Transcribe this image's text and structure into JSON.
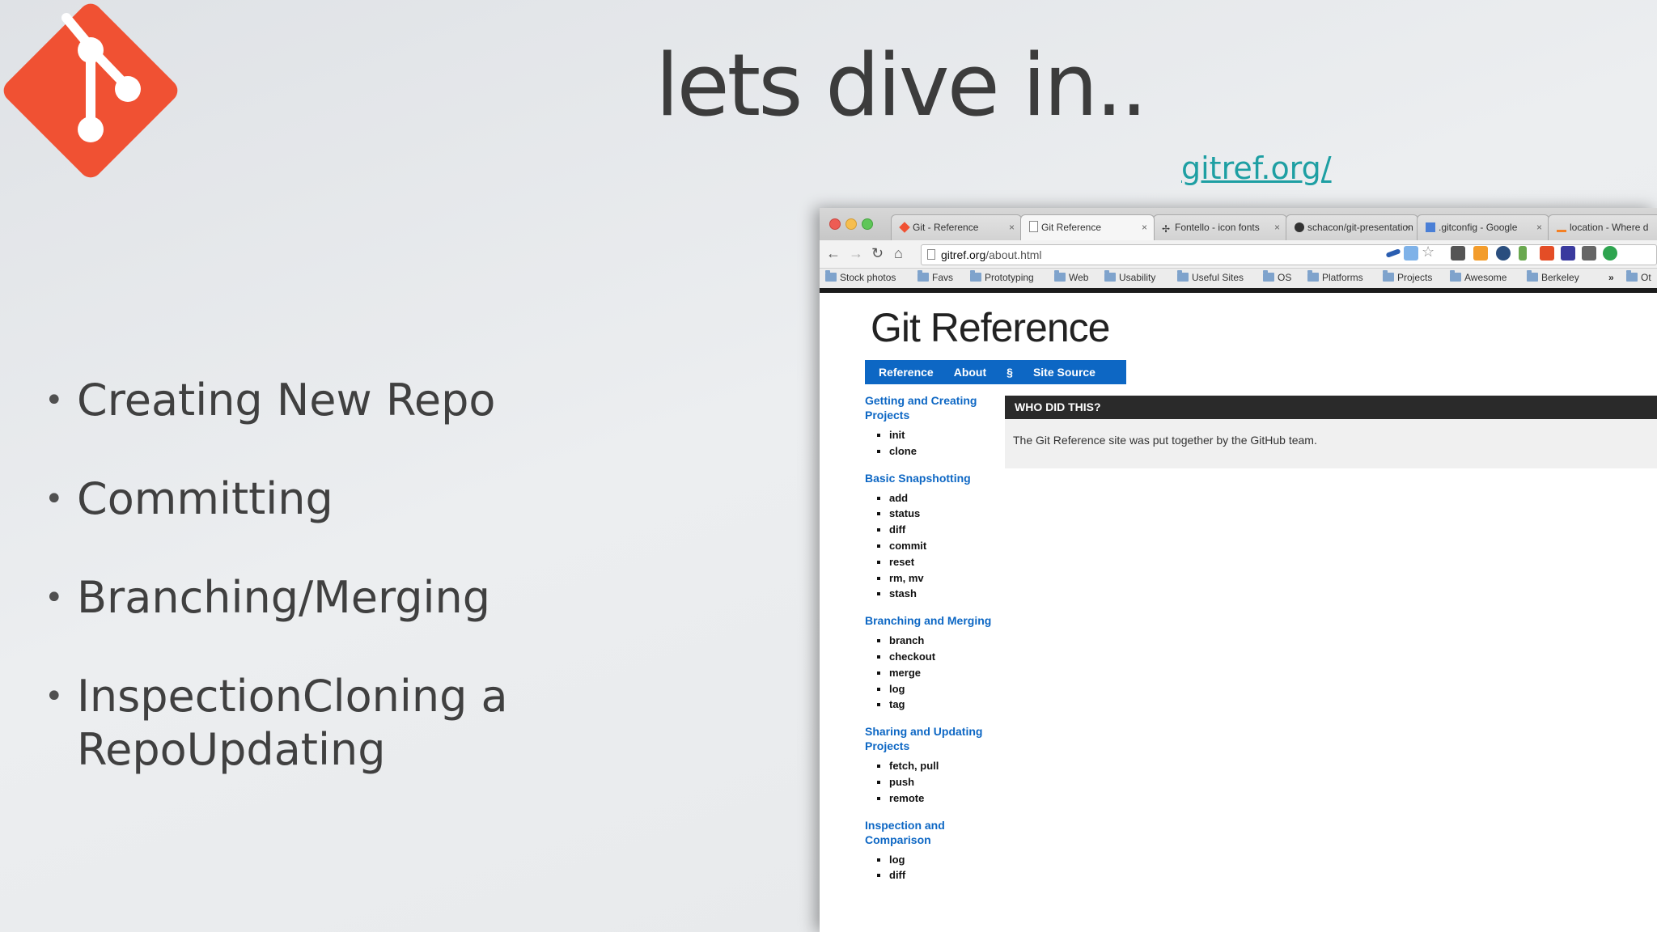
{
  "slide": {
    "title": "lets dive in..",
    "link": "gitref.org/",
    "bullets": [
      "Creating New Repo",
      "Committing",
      "Branching/Merging",
      "InspectionCloning a RepoUpdating"
    ]
  },
  "browser": {
    "tabs": [
      {
        "label": "Git - Reference",
        "active": false
      },
      {
        "label": "Git Reference",
        "active": true
      },
      {
        "label": "Fontello - icon fonts",
        "active": false
      },
      {
        "label": "schacon/git-presentation",
        "active": false
      },
      {
        "label": ".gitconfig - Google",
        "active": false
      },
      {
        "label": "location - Where d",
        "active": false
      }
    ],
    "url_host": "gitref.org",
    "url_path": "/about.html",
    "bookmarks": [
      "Stock photos",
      "Favs",
      "Prototyping",
      "Web",
      "Usability",
      "Useful Sites",
      "OS",
      "Platforms",
      "Projects",
      "Awesome",
      "Berkeley",
      "Ot"
    ],
    "bookmarks_more": "»"
  },
  "site": {
    "title": "Git Reference",
    "nav": [
      "Reference",
      "About",
      "§",
      "Site Source"
    ],
    "sections": [
      {
        "title": "Getting and Creating Projects",
        "items": [
          "init",
          "clone"
        ]
      },
      {
        "title": "Basic Snapshotting",
        "items": [
          "add",
          "status",
          "diff",
          "commit",
          "reset",
          "rm, mv",
          "stash"
        ]
      },
      {
        "title": "Branching and Merging",
        "items": [
          "branch",
          "checkout",
          "merge",
          "log",
          "tag"
        ]
      },
      {
        "title": "Sharing and Updating Projects",
        "items": [
          "fetch, pull",
          "push",
          "remote"
        ]
      },
      {
        "title": "Inspection and Comparison",
        "items": [
          "log",
          "diff"
        ]
      }
    ],
    "panel_title": "WHO DID THIS?",
    "panel_text": "The Git Reference site was put together by the GitHub team."
  },
  "colors": {
    "git_logo": "#f05133",
    "link": "#1e9fa3",
    "site_blue": "#0d67c4"
  }
}
